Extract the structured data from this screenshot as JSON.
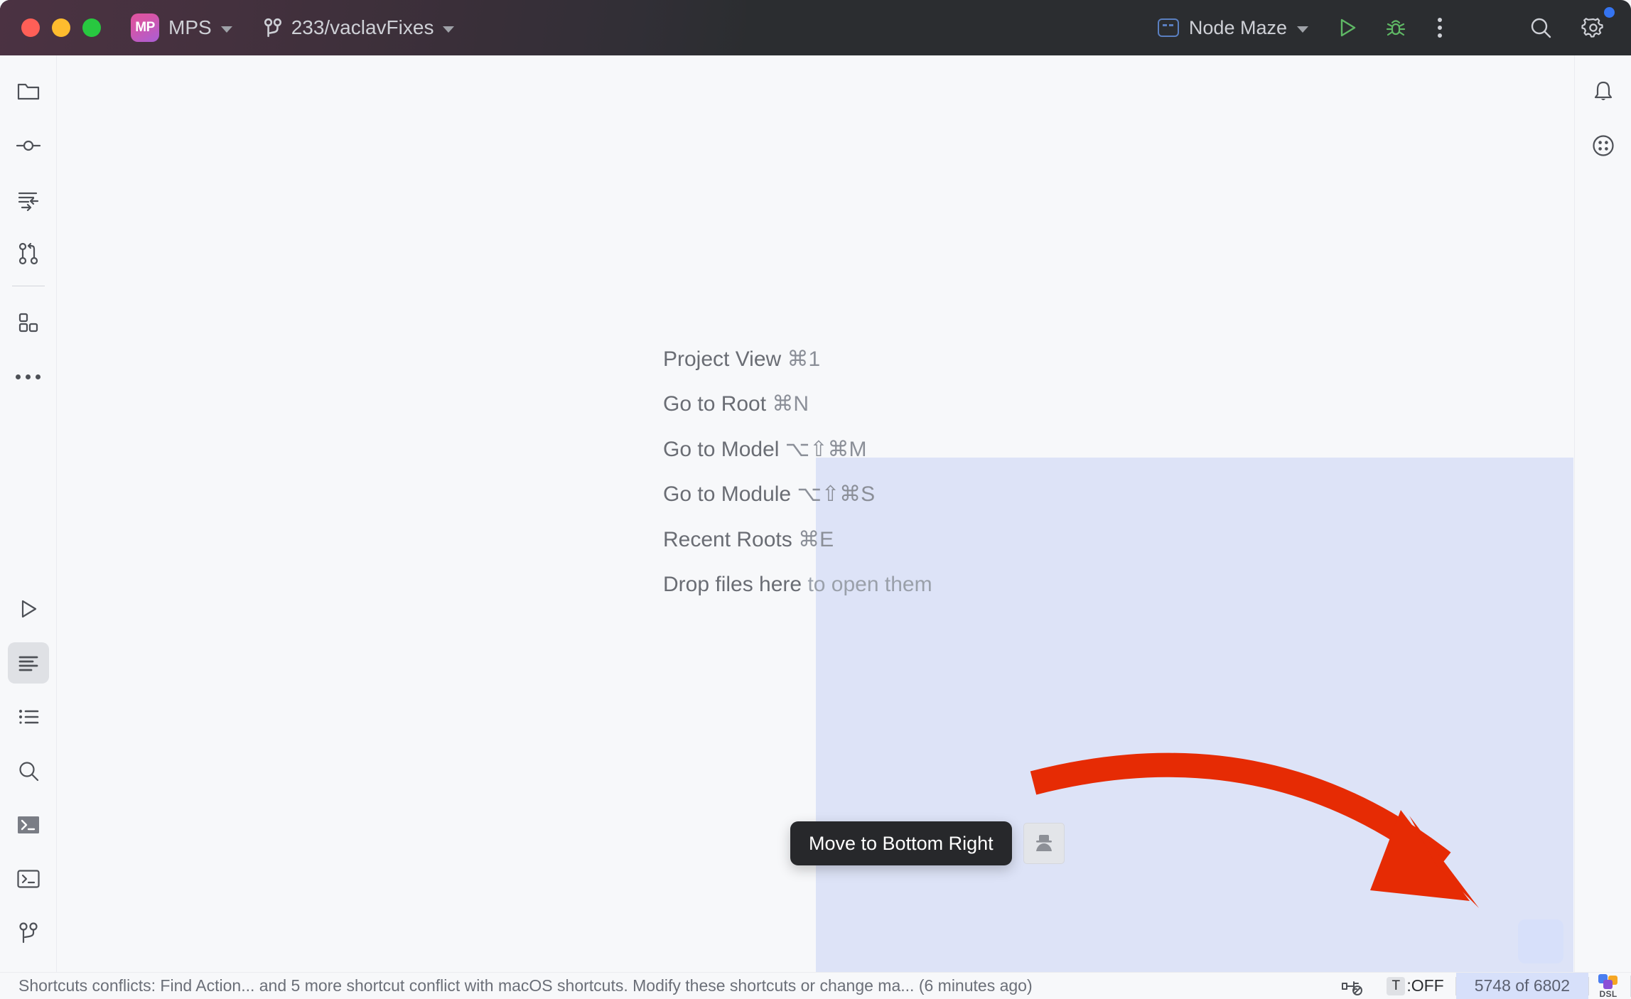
{
  "window": {
    "app_name": "MPS",
    "app_badge": "MP",
    "branch": "233/vaclavFixes",
    "run_config": "Node Maze"
  },
  "titlebar": {
    "traffic": [
      "close",
      "minimize",
      "maximize"
    ],
    "icons": {
      "vcs_branch": "branch-icon",
      "run": "run-icon",
      "debug": "debug-icon",
      "more": "more-options-icon",
      "search": "search-icon",
      "settings": "gear-icon"
    }
  },
  "sidebar_left": {
    "items": [
      {
        "name": "project",
        "icon": "folder-icon"
      },
      {
        "name": "commit",
        "icon": "commit-icon"
      },
      {
        "name": "changes",
        "icon": "changes-icon"
      },
      {
        "name": "pull-requests",
        "icon": "pull-request-icon"
      },
      {
        "name": "plugins",
        "icon": "modules-icon"
      },
      {
        "name": "more-tool-windows",
        "icon": "more-dots-icon"
      }
    ],
    "bottom_items": [
      {
        "name": "run",
        "icon": "run-icon",
        "selected": false
      },
      {
        "name": "messages",
        "icon": "messages-icon",
        "selected": true
      },
      {
        "name": "todo",
        "icon": "todo-list-icon",
        "selected": false
      },
      {
        "name": "find",
        "icon": "search-icon",
        "selected": false
      },
      {
        "name": "terminal",
        "icon": "terminal-filled-icon",
        "selected": false
      },
      {
        "name": "console",
        "icon": "terminal-outline-icon",
        "selected": false
      },
      {
        "name": "version-control",
        "icon": "branch-icon",
        "selected": false
      }
    ]
  },
  "sidebar_right": {
    "items": [
      {
        "name": "notifications",
        "icon": "bell-icon"
      },
      {
        "name": "widgets",
        "icon": "four-dots-circle-icon"
      }
    ]
  },
  "main": {
    "hints": [
      {
        "label": "Project View",
        "shortcut": "⌘1"
      },
      {
        "label": "Go to Root",
        "shortcut": "⌘N"
      },
      {
        "label": "Go to Model",
        "shortcut": "⌥⇧⌘M"
      },
      {
        "label": "Go to Module",
        "shortcut": "⌥⇧⌘S"
      },
      {
        "label": "Recent Roots",
        "shortcut": "⌘E"
      }
    ],
    "drop_hint_primary": "Drop files here",
    "drop_hint_secondary": "to open them",
    "tooltip": "Move to Bottom Right",
    "move_handle_icon": "avatar-icon",
    "drop_target_name": "bottom-right-drop-target",
    "annotation_arrow": "red-curved-arrow"
  },
  "statusbar": {
    "message": "Shortcuts conflicts: Find Action... and 5 more shortcut conflict with macOS shortcuts. Modify these shortcuts or change ma... (6 minutes ago)",
    "plug_icon": "plug-disabled-icon",
    "typing_badge": "T",
    "typing_state": ":OFF",
    "memory": "5748 of 6802",
    "dsl_label": "DSL"
  },
  "colors": {
    "titlebar_bg": "#2b2d30",
    "canvas_bg": "#f7f8fa",
    "drop_highlight": "#dde3f7",
    "accent_blue": "#3574f0",
    "arrow_red": "#e62b04",
    "tooltip_bg": "#27282b",
    "memory_highlight": "#d7e0fa"
  }
}
